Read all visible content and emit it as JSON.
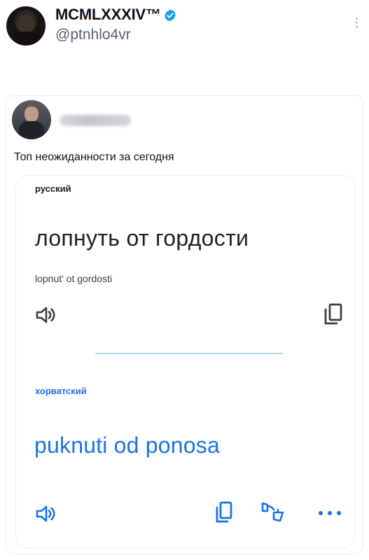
{
  "author": {
    "display_name": "MCMLXXXIV™",
    "handle": "@ptnhlo4vr",
    "verified": true
  },
  "quoted_post": {
    "text": "Топ неожиданности за сегодня"
  },
  "translate": {
    "source_language": "русский",
    "source_text": "лопнуть от гордости",
    "transliteration": "lopnut' ot gordosti",
    "target_language": "хорватский",
    "target_text": "puknuti od ponosa"
  },
  "colors": {
    "verified_blue": "#1d9bf0",
    "translate_blue": "#1a73e8"
  },
  "icons": [
    "verified-badge-icon",
    "more-options-icon",
    "speaker-icon",
    "copy-icon",
    "feedback-icon",
    "more-horizontal-icon"
  ]
}
